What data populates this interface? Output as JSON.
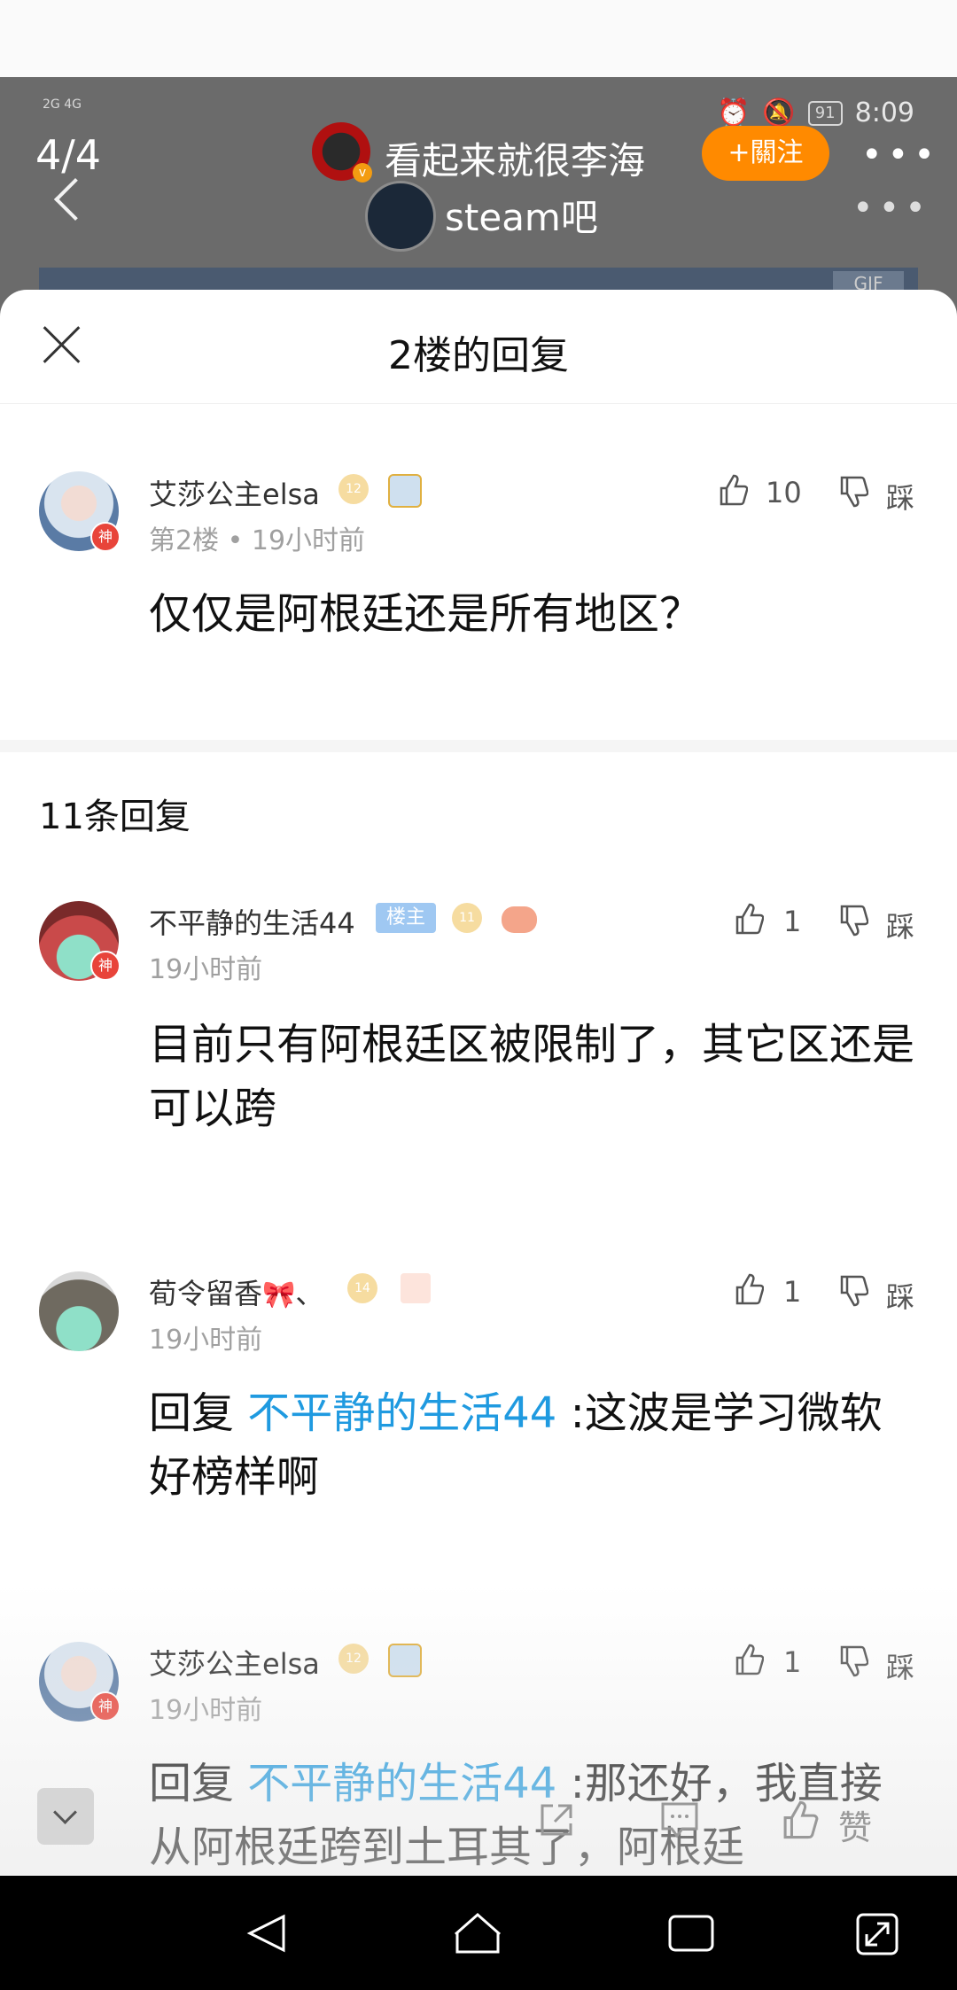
{
  "background": {
    "status_network": "2G 4G",
    "status_battery": "91",
    "status_time": "8:09",
    "page_counter": "4/4",
    "username": "看起来就很李海",
    "follow_label": "+關注",
    "forum_name": "steam吧",
    "gif_tag": "GIF"
  },
  "sheet": {
    "title": "2楼的回复"
  },
  "main_post": {
    "username": "艾莎公主elsa",
    "level": "12",
    "floor_time": "第2楼 • 19小时前",
    "like_count": "10",
    "dislike_label": "踩",
    "content": "仅仅是阿根廷还是所有地区？"
  },
  "reply_section": {
    "count_label": "11条回复"
  },
  "replies": [
    {
      "username": "不平静的生活44",
      "host_badge": "楼主",
      "level": "11",
      "time": "19小时前",
      "like_count": "1",
      "dislike_label": "踩",
      "content": "目前只有阿根廷区被限制了，其它区还是可以跨"
    },
    {
      "username": "荀令留香",
      "username_suffix": "、",
      "level": "14",
      "time": "19小时前",
      "like_count": "1",
      "dislike_label": "踩",
      "reply_prefix": "回复 ",
      "reply_to": "不平静的生活44",
      "content": " :这波是学习微软好榜样啊"
    },
    {
      "username": "艾莎公主elsa",
      "level": "12",
      "time": "19小时前",
      "like_count": "1",
      "dislike_label": "踩",
      "reply_prefix": "回复 ",
      "reply_to": "不平静的生活44",
      "content": " :那还好，我直接从阿根廷跨到土耳其了，阿根廷"
    }
  ],
  "action_bar": {
    "like_label": "赞"
  }
}
